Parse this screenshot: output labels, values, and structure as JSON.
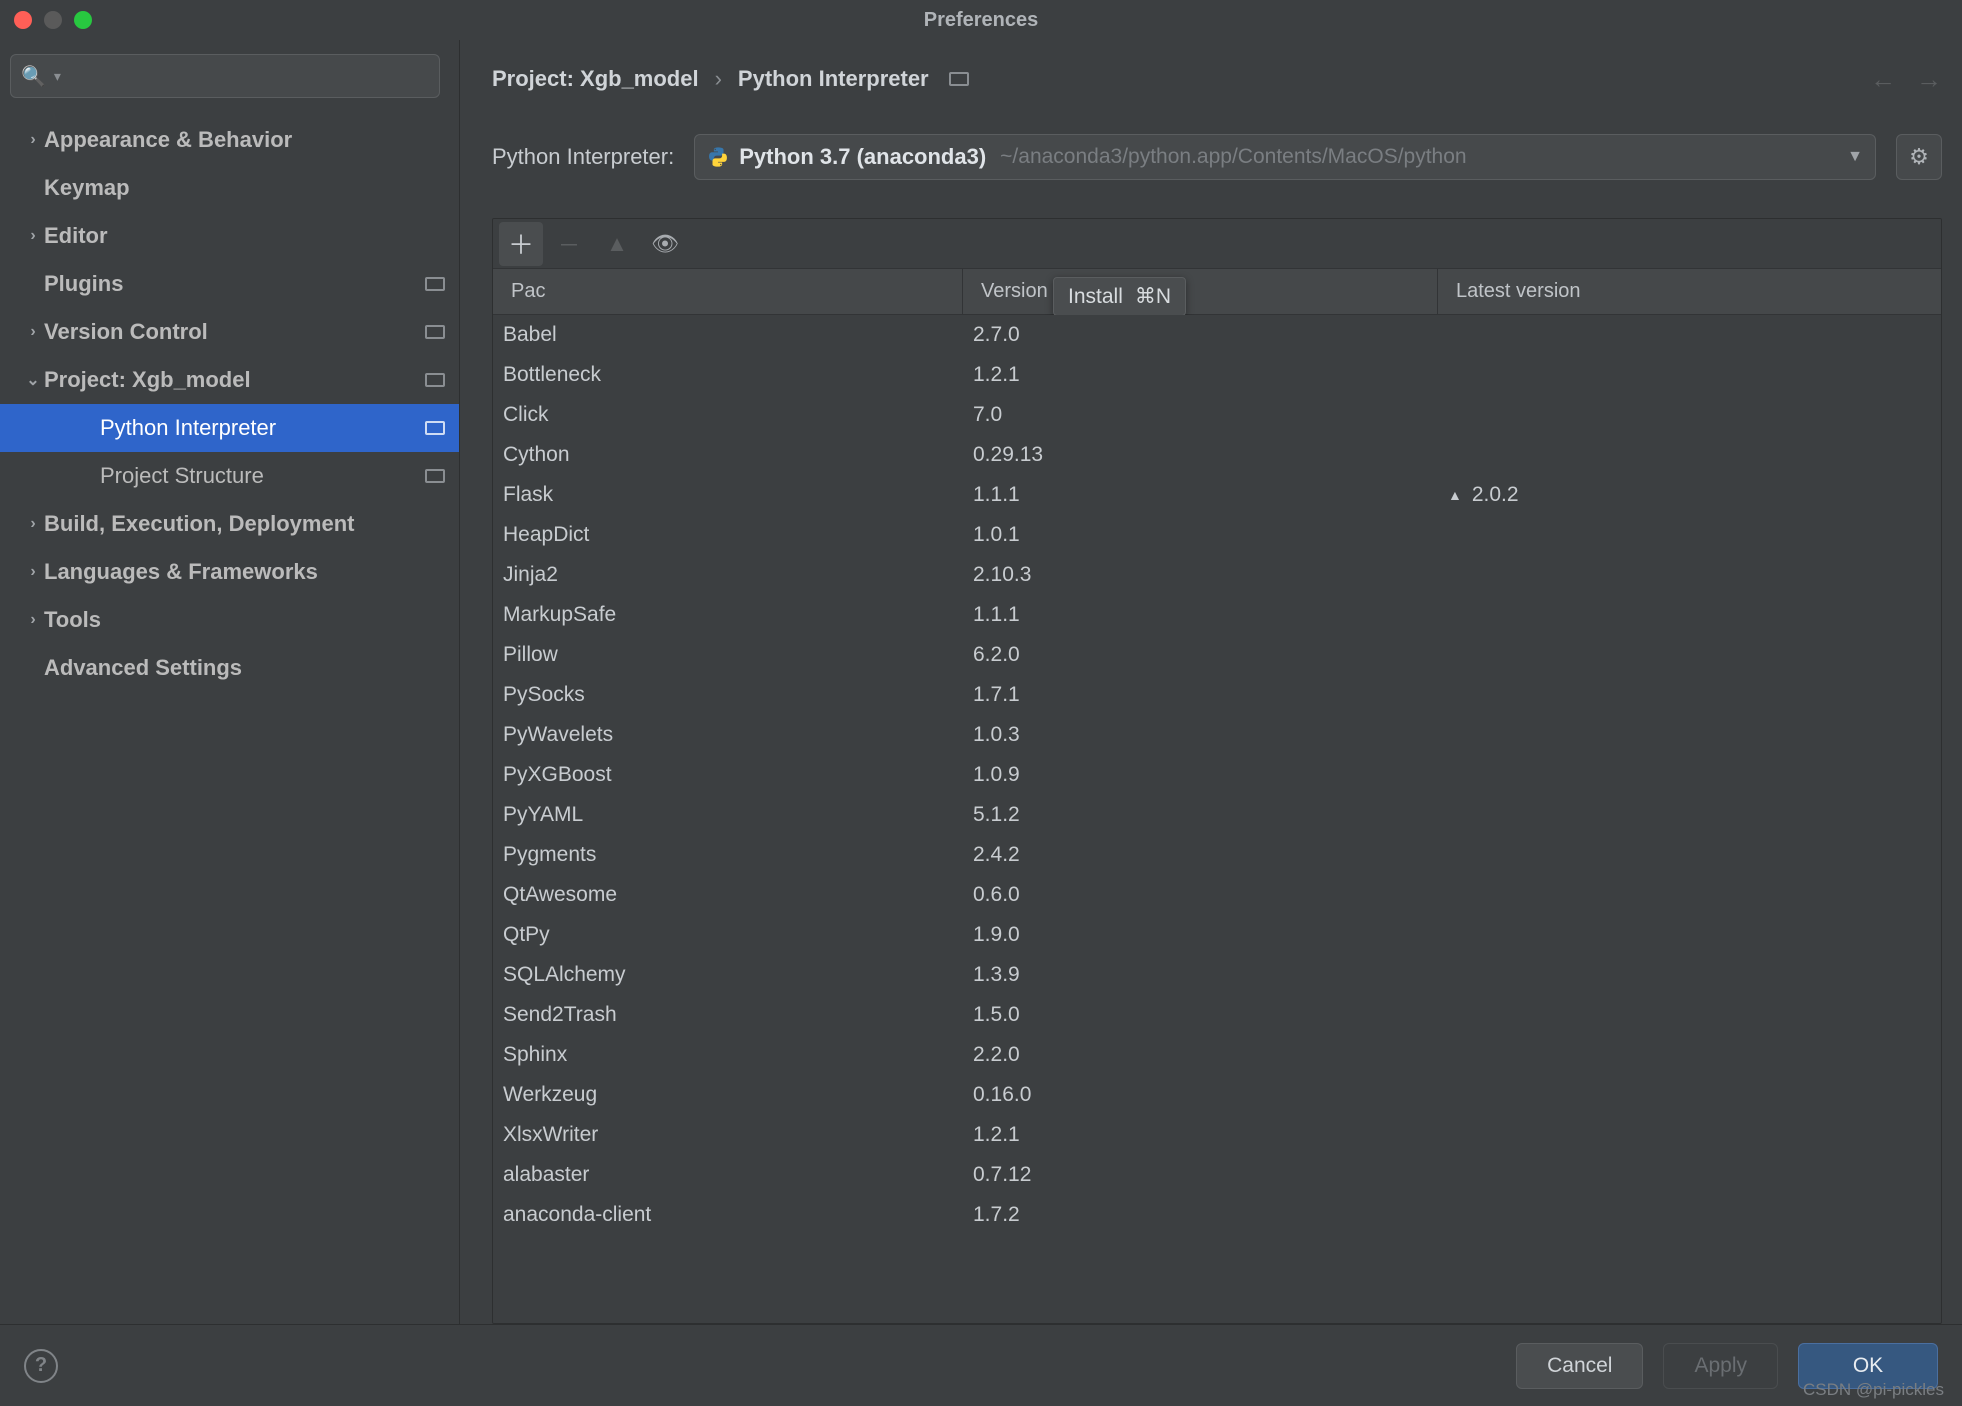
{
  "window": {
    "title": "Preferences"
  },
  "search": {
    "placeholder": ""
  },
  "sidebar": {
    "items": [
      {
        "label": "Appearance & Behavior",
        "bold": true,
        "expandable": true
      },
      {
        "label": "Keymap",
        "bold": true,
        "expandable": false
      },
      {
        "label": "Editor",
        "bold": true,
        "expandable": true
      },
      {
        "label": "Plugins",
        "bold": true,
        "expandable": false,
        "badge": true
      },
      {
        "label": "Version Control",
        "bold": true,
        "expandable": true,
        "badge": true
      },
      {
        "label": "Project: Xgb_model",
        "bold": true,
        "expandable": true,
        "expanded": true,
        "badge": true
      },
      {
        "label": "Python Interpreter",
        "bold": false,
        "expandable": false,
        "indent": true,
        "selected": true,
        "badge": true
      },
      {
        "label": "Project Structure",
        "bold": false,
        "expandable": false,
        "indent": true,
        "badge": true
      },
      {
        "label": "Build, Execution, Deployment",
        "bold": true,
        "expandable": true
      },
      {
        "label": "Languages & Frameworks",
        "bold": true,
        "expandable": true
      },
      {
        "label": "Tools",
        "bold": true,
        "expandable": true
      },
      {
        "label": "Advanced Settings",
        "bold": true,
        "expandable": false
      }
    ]
  },
  "breadcrumb": {
    "root": "Project: Xgb_model",
    "leaf": "Python Interpreter"
  },
  "interpreter": {
    "label": "Python Interpreter:",
    "name": "Python 3.7 (anaconda3)",
    "path": "~/anaconda3/python.app/Contents/MacOS/python"
  },
  "tooltip": {
    "label": "Install",
    "shortcut": "⌘N"
  },
  "table": {
    "headers": {
      "package": "Package",
      "version": "Version",
      "latest": "Latest version"
    },
    "truncated_header": "Pac",
    "rows": [
      {
        "name": "Babel",
        "version": "2.7.0",
        "latest": ""
      },
      {
        "name": "Bottleneck",
        "version": "1.2.1",
        "latest": ""
      },
      {
        "name": "Click",
        "version": "7.0",
        "latest": ""
      },
      {
        "name": "Cython",
        "version": "0.29.13",
        "latest": ""
      },
      {
        "name": "Flask",
        "version": "1.1.1",
        "latest": "2.0.2",
        "upgrade": true
      },
      {
        "name": "HeapDict",
        "version": "1.0.1",
        "latest": ""
      },
      {
        "name": "Jinja2",
        "version": "2.10.3",
        "latest": ""
      },
      {
        "name": "MarkupSafe",
        "version": "1.1.1",
        "latest": ""
      },
      {
        "name": "Pillow",
        "version": "6.2.0",
        "latest": ""
      },
      {
        "name": "PySocks",
        "version": "1.7.1",
        "latest": ""
      },
      {
        "name": "PyWavelets",
        "version": "1.0.3",
        "latest": ""
      },
      {
        "name": "PyXGBoost",
        "version": "1.0.9",
        "latest": ""
      },
      {
        "name": "PyYAML",
        "version": "5.1.2",
        "latest": ""
      },
      {
        "name": "Pygments",
        "version": "2.4.2",
        "latest": ""
      },
      {
        "name": "QtAwesome",
        "version": "0.6.0",
        "latest": ""
      },
      {
        "name": "QtPy",
        "version": "1.9.0",
        "latest": ""
      },
      {
        "name": "SQLAlchemy",
        "version": "1.3.9",
        "latest": ""
      },
      {
        "name": "Send2Trash",
        "version": "1.5.0",
        "latest": ""
      },
      {
        "name": "Sphinx",
        "version": "2.2.0",
        "latest": ""
      },
      {
        "name": "Werkzeug",
        "version": "0.16.0",
        "latest": ""
      },
      {
        "name": "XlsxWriter",
        "version": "1.2.1",
        "latest": ""
      },
      {
        "name": "alabaster",
        "version": "0.7.12",
        "latest": ""
      },
      {
        "name": "anaconda-client",
        "version": "1.7.2",
        "latest": ""
      }
    ]
  },
  "footer": {
    "cancel": "Cancel",
    "apply": "Apply",
    "ok": "OK"
  },
  "watermark": "CSDN @pi-pickles"
}
